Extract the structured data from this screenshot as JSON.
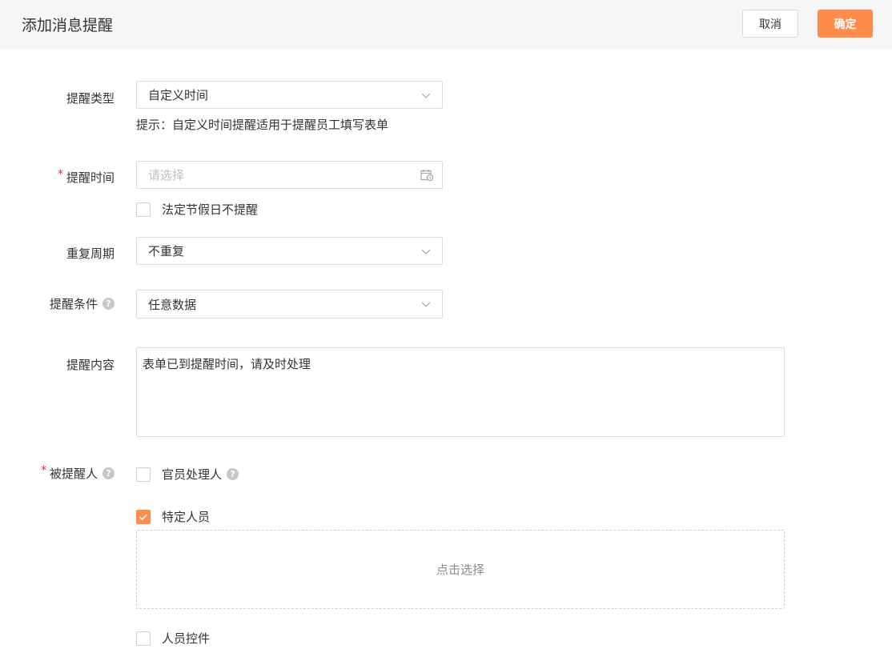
{
  "header": {
    "title": "添加消息提醒",
    "cancel_label": "取消",
    "confirm_label": "确定"
  },
  "form": {
    "reminder_type": {
      "label": "提醒类型",
      "value": "自定义时间",
      "hint": "提示：自定义时间提醒适用于提醒员工填写表单"
    },
    "reminder_time": {
      "required_mark": "*",
      "label": "提醒时间",
      "placeholder": "请选择",
      "holiday_option": "法定节假日不提醒",
      "holiday_checked": false
    },
    "repeat": {
      "label": "重复周期",
      "value": "不重复"
    },
    "condition": {
      "label": "提醒条件",
      "help": "?",
      "value": "任意数据"
    },
    "content": {
      "label": "提醒内容",
      "value": "表单已到提醒时间，请及时处理"
    },
    "recipients": {
      "required_mark": "*",
      "label": "被提醒人",
      "help": "?",
      "options": [
        {
          "label": "官员处理人",
          "checked": false,
          "help": "?"
        },
        {
          "label": "特定人员",
          "checked": true
        },
        {
          "label": "人员控件",
          "checked": false
        }
      ],
      "picker_label": "点击选择"
    }
  },
  "colors": {
    "accent": "#ff8c4b",
    "required": "#f5222d",
    "header_bg": "#f6f6f6"
  }
}
